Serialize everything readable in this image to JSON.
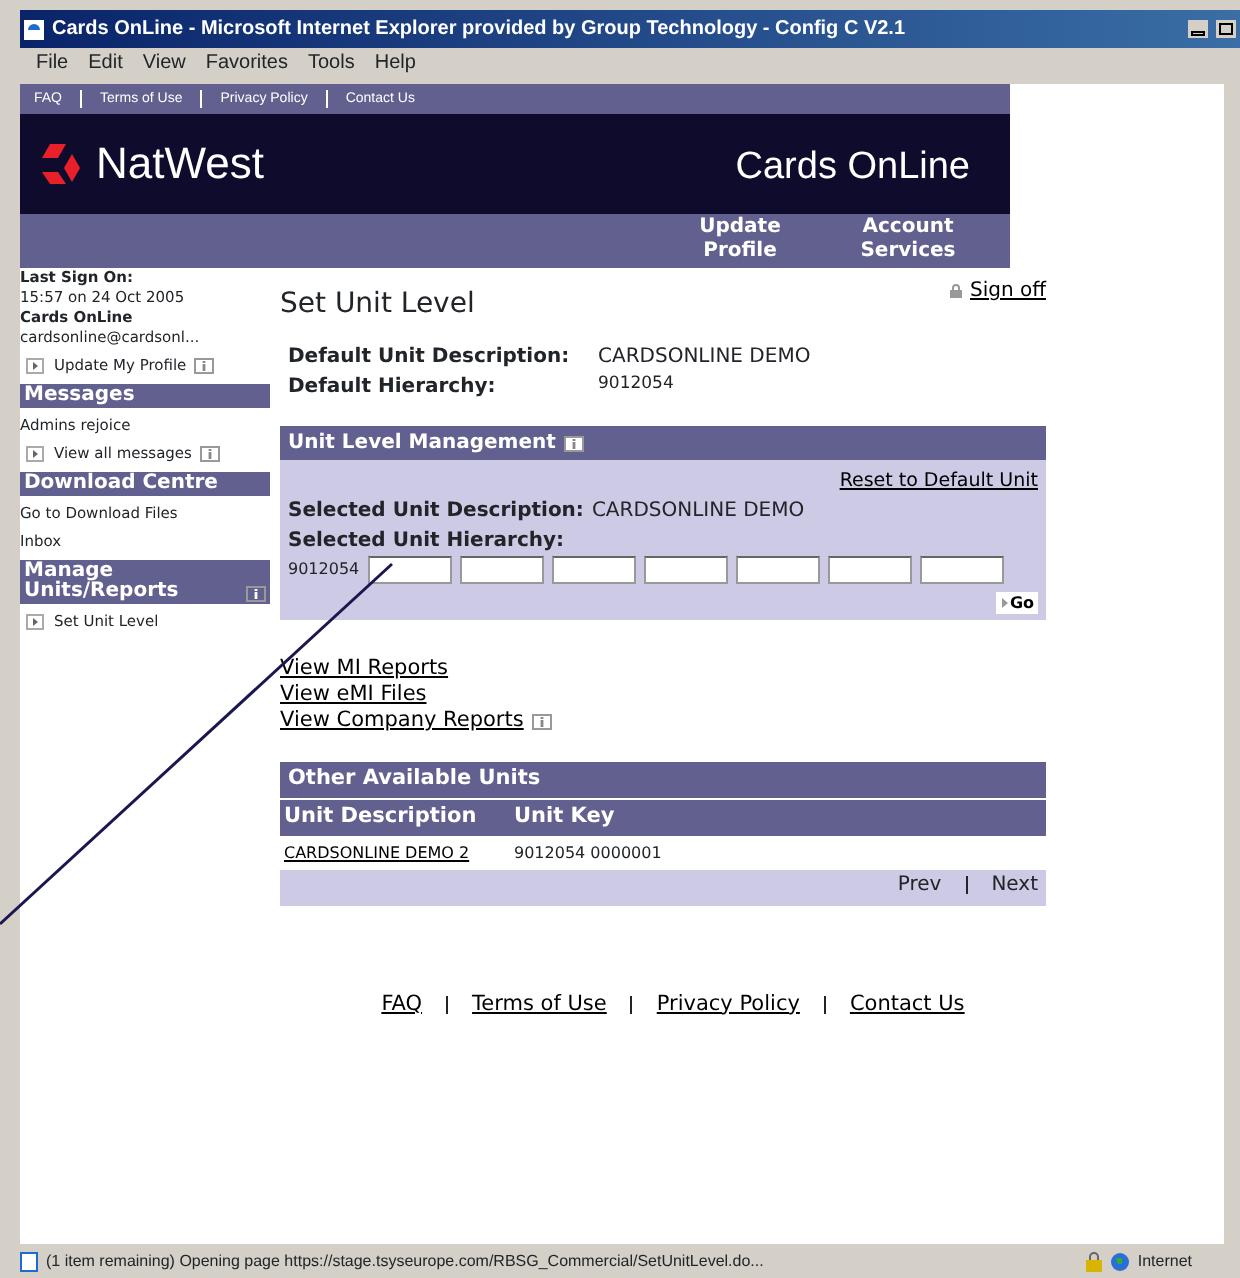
{
  "window": {
    "title": "Cards OnLine - Microsoft Internet Explorer provided by Group Technology - Config C V2.1"
  },
  "menu": [
    "File",
    "Edit",
    "View",
    "Favorites",
    "Tools",
    "Help"
  ],
  "top_links": [
    "FAQ",
    "Terms of Use",
    "Privacy Policy",
    "Contact Us"
  ],
  "brand": {
    "logo": "NatWest",
    "product": "Cards OnLine"
  },
  "nav": [
    "Update Profile",
    "Account Services"
  ],
  "sidebar": {
    "last_sign_on_label": "Last Sign On:",
    "last_sign_on": "15:57 on 24 Oct 2005",
    "user": "Cards OnLine",
    "email": "cardsonline@cardsonl...",
    "profile_link": "Update My Profile",
    "sections": [
      {
        "title": "Messages",
        "info": false,
        "items": [
          {
            "kind": "plain",
            "text": "Admins rejoice"
          },
          {
            "kind": "link",
            "text": "View all messages",
            "info": true
          }
        ]
      },
      {
        "title": "Download Centre",
        "info": false,
        "items": [
          {
            "kind": "plain",
            "text": "Go to Download Files"
          },
          {
            "kind": "plain",
            "text": "Inbox"
          }
        ]
      },
      {
        "title": "Manage Units/Reports",
        "info": true,
        "items": [
          {
            "kind": "link",
            "text": "Set Unit Level",
            "info": false
          }
        ]
      }
    ]
  },
  "main": {
    "title": "Set Unit Level",
    "sign_off": "Sign off",
    "defaults": [
      {
        "label": "Default Unit Description:",
        "value": "CARDSONLINE DEMO"
      },
      {
        "label": "Default Hierarchy:",
        "value": "9012054"
      }
    ],
    "unit_panel": {
      "title": "Unit Level Management",
      "reset": "Reset to Default Unit",
      "description_label": "Selected Unit Description:",
      "description": "CARDSONLINE DEMO",
      "hierarchy_label": "Selected Unit Hierarchy:",
      "hierarchy_prefix": "9012054",
      "go": "Go"
    },
    "report_links": [
      {
        "text": "View MI Reports",
        "info": false
      },
      {
        "text": "View eMI Files",
        "info": false
      },
      {
        "text": "View Company Reports",
        "info": true
      }
    ],
    "other_units": {
      "title": "Other Available Units",
      "columns": [
        "Unit Description",
        "Unit Key"
      ],
      "rows": [
        [
          "CARDSONLINE DEMO 2",
          "9012054 0000001"
        ]
      ],
      "pager": [
        "Prev",
        "Next"
      ]
    }
  },
  "footer_links": [
    "FAQ",
    "Terms of Use",
    "Privacy Policy",
    "Contact Us"
  ],
  "status_bar": {
    "text": "(1 item remaining) Opening page https://stage.tsyseurope.com/RBSG_Commercial/SetUnitLevel.do...",
    "zone": "Internet"
  }
}
